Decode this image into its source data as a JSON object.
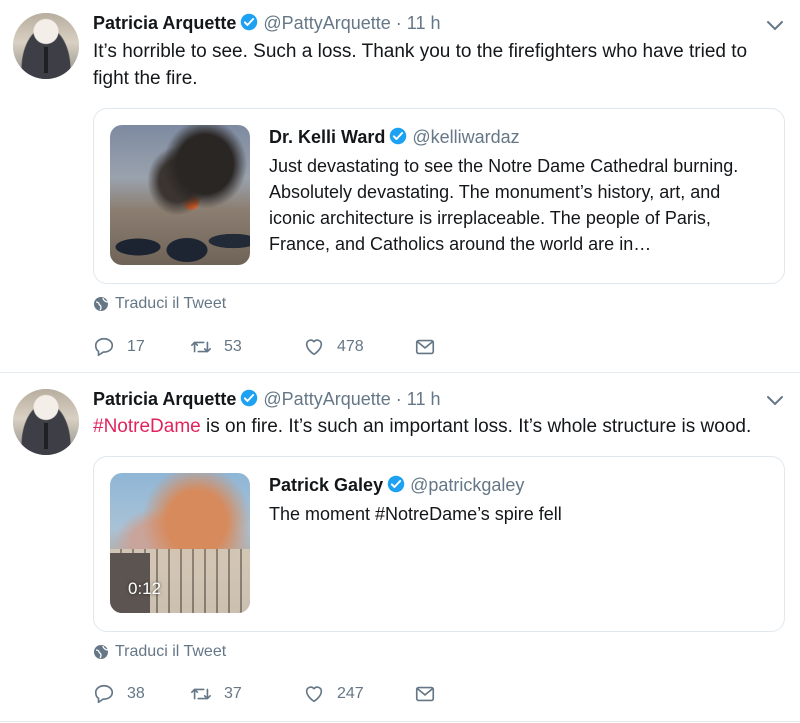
{
  "colors": {
    "hashtag": "#e0245e",
    "verified": "#1da1f2",
    "muted": "#657786"
  },
  "tweets": [
    {
      "author": "Patricia Arquette",
      "handle": "@PattyArquette",
      "separator": "·",
      "time": "11 h",
      "text": "It’s horrible to see. Such a loss. Thank you to the firefighters who have tried to fight the fire.",
      "quote": {
        "author": "Dr. Kelli Ward",
        "handle": "@kelliwardaz",
        "text": "Just devastating to see the Notre Dame Cathedral burning. Absolutely devastating. The monument’s history, art, and iconic architecture is irreplaceable. The people of Paris, France, and Catholics around the world are in…"
      },
      "translate": "Traduci il Tweet",
      "replies": "17",
      "retweets": "53",
      "likes": "478"
    },
    {
      "author": "Patricia Arquette",
      "handle": "@PattyArquette",
      "separator": "·",
      "time": "11 h",
      "hashtag": "#NotreDame",
      "text_rest": " is on fire. It’s such an important loss. It’s whole structure is wood.",
      "quote": {
        "author": "Patrick Galey",
        "handle": "@patrickgaley",
        "text": "The moment #NotreDame’s spire fell",
        "video_duration": "0:12"
      },
      "translate": "Traduci il Tweet",
      "replies": "38",
      "retweets": "37",
      "likes": "247"
    }
  ]
}
